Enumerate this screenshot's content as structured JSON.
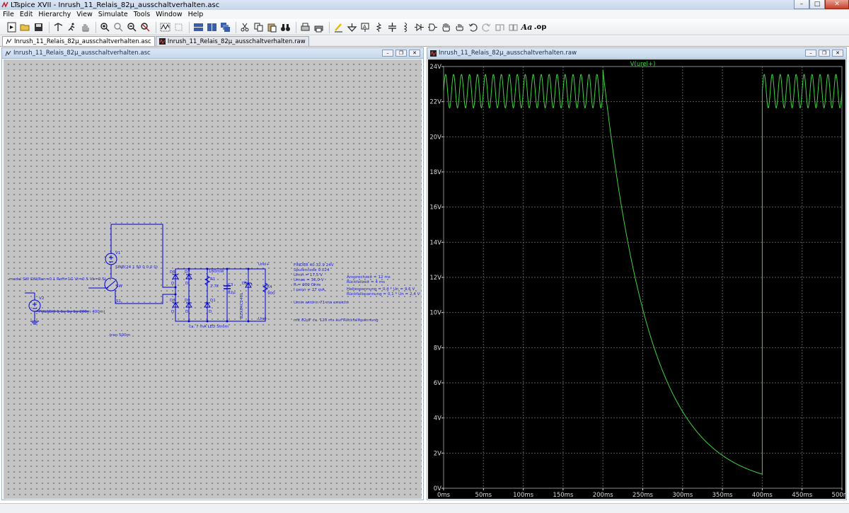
{
  "window": {
    "title": "LTspice XVII - Inrush_11_Relais_82µ_ausschaltverhalten.asc"
  },
  "menu": [
    "File",
    "Edit",
    "Hierarchy",
    "View",
    "Simulate",
    "Tools",
    "Window",
    "Help"
  ],
  "toolbar": {
    "font_label": "Aa",
    ".op_label": ".op"
  },
  "tabs": [
    {
      "label": "Inrush_11_Relais_82µ_ausschaltverhalten.asc"
    },
    {
      "label": "Inrush_11_Relais_82µ_ausschaltverhalten.raw"
    }
  ],
  "schematic": {
    "title": "Inrush_11_Relais_82µ_ausschaltverhalten.asc",
    "model": ".model SW SW(Ron=0.1 Roff=1G Vt=0.5 Vh=0.5)",
    "tran": ".tran 500m",
    "v1": {
      "name": "V1",
      "value": "SINE(24 1 50 0 0 0 0)"
    },
    "v2": {
      "name": "V2",
      "value": "PULSE(0 1 1u 1u 1u 200m 400m)"
    },
    "s1": {
      "name": "S1",
      "model": "SW"
    },
    "diodes": [
      {
        "name": "D6",
        "model": "D"
      },
      {
        "name": "D7",
        "model": "D"
      },
      {
        "name": "D8",
        "model": "D"
      },
      {
        "name": "D9",
        "model": "D"
      },
      {
        "name": "D1",
        "model": "D"
      }
    ],
    "r1": {
      "name": "R1",
      "value": "2.7k"
    },
    "c3": {
      "name": "C3",
      "value": "82µ"
    },
    "d5": {
      "name": "D5",
      "value": "BZX84C24VL"
    },
    "r4": {
      "name": "R4",
      "value": "900"
    },
    "power_note": "180mW",
    "net_top": "Urel+",
    "net_bottom": "Urel-",
    "led_note": "ca. 7 mA LED Strom",
    "relay_info": [
      "FINDER 40.32.9 24V",
      "Spulencode 9.024",
      "Umin = 17,5 V",
      "Umax = 36,0 V",
      "R = 900 Ohm",
      "I nenn = 27 mA"
    ],
    "relay_times": [
      "Ansprechzeit = 12 ms",
      "Rückfallzeit = 4 ms",
      "Haltespannung = 0,4 * Un = 9,6 V",
      "Rückfallspannung = 0,1 * Un = 2,4 V"
    ],
    "umin_note": "Umin wird in 71 ms erreicht",
    "cap_note": "mit 82µF ca. 120 ms auf Rückfallspannung"
  },
  "plot": {
    "title": "Inrush_11_Relais_82µ_ausschaltverhalten.raw",
    "colors": {
      "background": "#000000",
      "grid": "#5a5a5a",
      "trace": "#3fd23f",
      "text": "#d8d8d8"
    }
  },
  "chart_data": {
    "type": "line",
    "title": "",
    "xlabel": "",
    "ylabel": "",
    "xlim": [
      0,
      500
    ],
    "ylim": [
      0,
      24
    ],
    "xticks": [
      "0ms",
      "50ms",
      "100ms",
      "150ms",
      "200ms",
      "250ms",
      "300ms",
      "350ms",
      "400ms",
      "450ms",
      "500ms"
    ],
    "yticks": [
      "0V",
      "2V",
      "4V",
      "6V",
      "8V",
      "10V",
      "12V",
      "14V",
      "16V",
      "18V",
      "20V",
      "22V",
      "24V"
    ],
    "grid": true,
    "series": [
      {
        "name": "V(urel+)",
        "color": "#3fd23f",
        "segments": [
          {
            "kind": "ripple",
            "x_start": 0,
            "x_end": 200,
            "center": 22.6,
            "amplitude": 0.95,
            "freq_hz": 100
          },
          {
            "kind": "decay",
            "x_start": 200,
            "x_end": 400,
            "y_start": 23.8,
            "y_end": 0.8
          },
          {
            "kind": "jump",
            "x": 400,
            "y_from": 0.8,
            "y_to": 21.6
          },
          {
            "kind": "ripple",
            "x_start": 400,
            "x_end": 500,
            "center": 22.6,
            "amplitude": 0.95,
            "freq_hz": 100
          }
        ]
      }
    ]
  }
}
